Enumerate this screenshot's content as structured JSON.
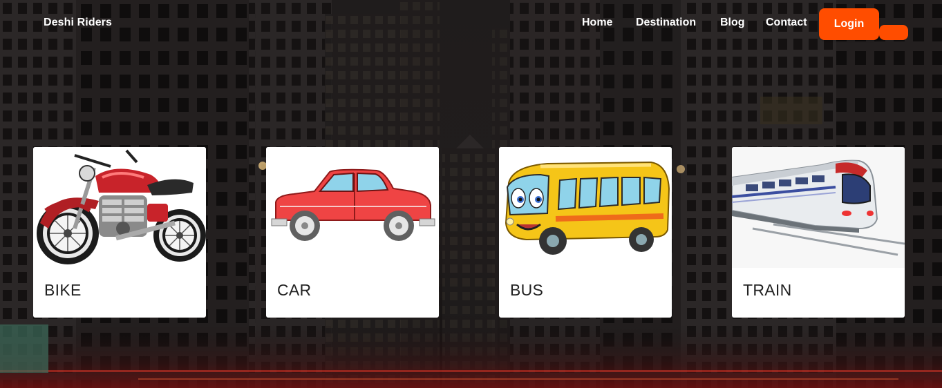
{
  "header": {
    "brand": "Deshi Riders",
    "nav": [
      {
        "label": "Home"
      },
      {
        "label": "Destination"
      },
      {
        "label": "Blog"
      },
      {
        "label": "Contact"
      }
    ],
    "login_label": "Login"
  },
  "cards": [
    {
      "label": "BIKE",
      "icon": "motorcycle-image"
    },
    {
      "label": "CAR",
      "icon": "car-image"
    },
    {
      "label": "BUS",
      "icon": "bus-image"
    },
    {
      "label": "TRAIN",
      "icon": "train-image"
    }
  ],
  "colors": {
    "accent": "#ff4d00",
    "card_bg": "#ffffff"
  }
}
